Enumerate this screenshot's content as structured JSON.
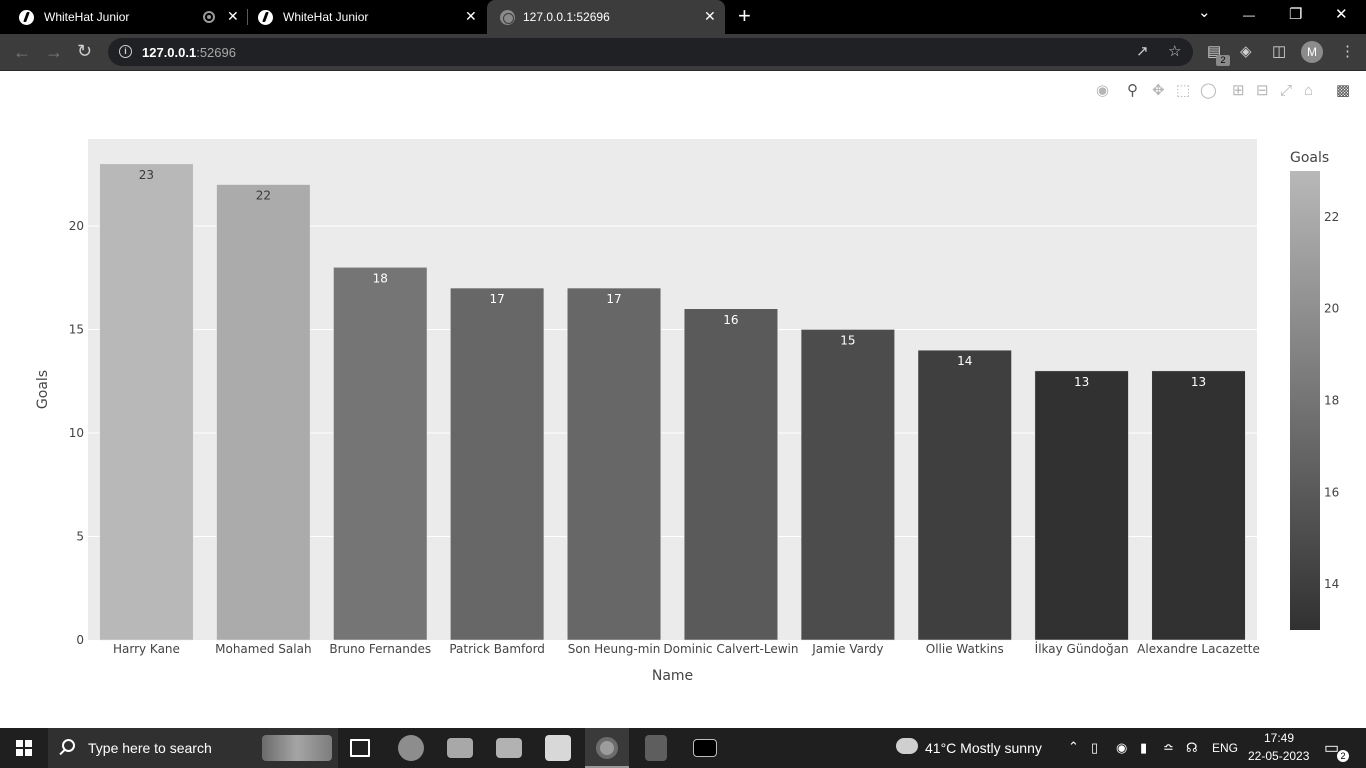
{
  "browser": {
    "tabs": [
      {
        "title": "WhiteHat Junior",
        "close": "✕"
      },
      {
        "title": "WhiteHat Junior",
        "close": "✕"
      },
      {
        "title": "127.0.0.1:52696",
        "close": "✕"
      }
    ],
    "new_tab": "+",
    "url_host": "127.0.0.1",
    "url_port": ":52696",
    "extension_badge": "2",
    "profile_initial": "M",
    "window_controls": [
      "⌄",
      "—",
      "❐",
      "✕"
    ]
  },
  "chart_data": {
    "type": "bar",
    "categories": [
      "Harry Kane",
      "Mohamed Salah",
      "Bruno Fernandes",
      "Patrick Bamford",
      "Son Heung-min",
      "Dominic Calvert-Lewin",
      "Jamie Vardy",
      "Ollie Watkins",
      "İlkay Gündoğan",
      "Alexandre Lacazette"
    ],
    "values": [
      23,
      22,
      18,
      17,
      17,
      16,
      15,
      14,
      13,
      13
    ],
    "xlabel": "Name",
    "ylabel": "Goals",
    "ylim": [
      0,
      24.2
    ],
    "yticks": [
      0,
      5,
      10,
      15,
      20
    ],
    "grid": true,
    "colorbar": {
      "title": "Goals",
      "ticks": [
        14,
        16,
        18,
        20,
        22
      ],
      "range": [
        13,
        23
      ],
      "color_low": "#313131",
      "color_high": "#b8b8b8"
    },
    "plot_background": "#ebebeb"
  },
  "taskbar": {
    "search_placeholder": "Type here to search",
    "weather": "41°C  Mostly sunny",
    "language": "ENG",
    "time": "17:49",
    "date": "22-05-2023",
    "notifications": "2"
  }
}
